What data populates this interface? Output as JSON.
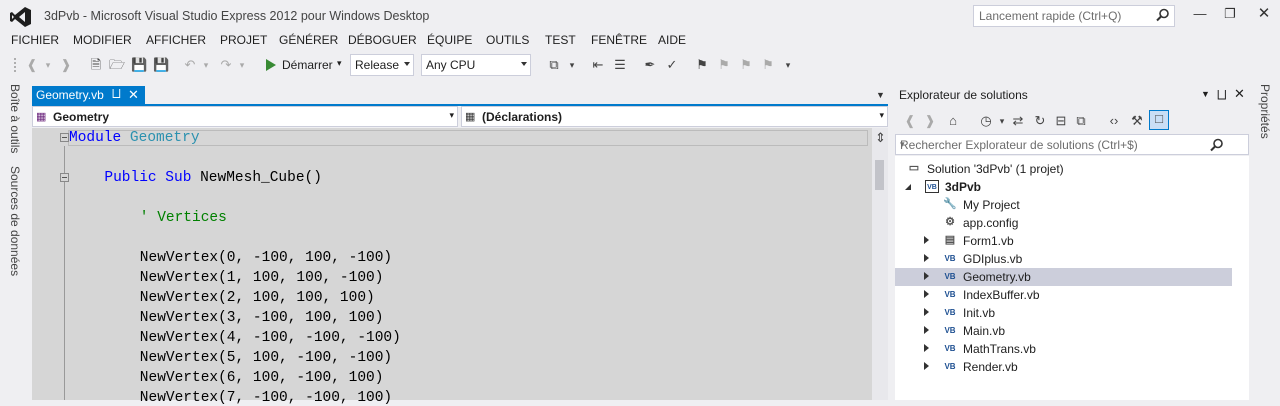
{
  "window": {
    "title": "3dPvb - Microsoft Visual Studio Express 2012 pour Windows Desktop",
    "quick_launch_placeholder": "Lancement rapide (Ctrl+Q)"
  },
  "menu": [
    "FICHIER",
    "MODIFIER",
    "AFFICHER",
    "PROJET",
    "GÉNÉRER",
    "DÉBOGUER",
    "ÉQUIPE",
    "OUTILS",
    "TEST",
    "FENÊTRE",
    "AIDE"
  ],
  "toolbar": {
    "start_label": "Démarrer",
    "config": "Release",
    "platform": "Any CPU"
  },
  "left_tabs": [
    "Boîte à outils",
    "Sources de données"
  ],
  "right_tabs": [
    "Propriétés"
  ],
  "editor": {
    "tab_label": "Geometry.vb",
    "nav_left": "Geometry",
    "nav_right": "(Déclarations)",
    "lines": [
      {
        "indent": 0,
        "parts": [
          {
            "c": "kw",
            "t": "Module "
          },
          {
            "c": "ty",
            "t": "Geometry"
          }
        ]
      },
      {
        "indent": 4,
        "parts": [
          {
            "c": "kw",
            "t": "Public Sub "
          },
          {
            "c": "",
            "t": "NewMesh_Cube()"
          }
        ]
      },
      {
        "indent": 8,
        "parts": [
          {
            "c": "cm",
            "t": "' Vertices"
          }
        ]
      },
      {
        "indent": 8,
        "parts": [
          {
            "c": "",
            "t": "NewVertex(0, -100, 100, -100)"
          }
        ]
      },
      {
        "indent": 8,
        "parts": [
          {
            "c": "",
            "t": "NewVertex(1, 100, 100, -100)"
          }
        ]
      },
      {
        "indent": 8,
        "parts": [
          {
            "c": "",
            "t": "NewVertex(2, 100, 100, 100)"
          }
        ]
      },
      {
        "indent": 8,
        "parts": [
          {
            "c": "",
            "t": "NewVertex(3, -100, 100, 100)"
          }
        ]
      },
      {
        "indent": 8,
        "parts": [
          {
            "c": "",
            "t": "NewVertex(4, -100, -100, -100)"
          }
        ]
      },
      {
        "indent": 8,
        "parts": [
          {
            "c": "",
            "t": "NewVertex(5, 100, -100, -100)"
          }
        ]
      },
      {
        "indent": 8,
        "parts": [
          {
            "c": "",
            "t": "NewVertex(6, 100, -100, 100)"
          }
        ]
      },
      {
        "indent": 8,
        "parts": [
          {
            "c": "",
            "t": "NewVertex(7, -100, -100, 100)"
          }
        ]
      }
    ]
  },
  "solution_explorer": {
    "title": "Explorateur de solutions",
    "search_placeholder": "Rechercher Explorateur de solutions (Ctrl+$)",
    "items": [
      {
        "label": "Solution '3dPvb' (1 projet)",
        "icon": "solution-icon",
        "expand": "none",
        "bold": false,
        "selected": false
      },
      {
        "label": "3dPvb",
        "icon": "vb-project-icon",
        "expand": "expanded",
        "bold": true,
        "selected": false
      },
      {
        "label": "My Project",
        "icon": "wrench-icon",
        "expand": "none",
        "bold": false,
        "selected": false
      },
      {
        "label": "app.config",
        "icon": "config-file-icon",
        "expand": "none",
        "bold": false,
        "selected": false
      },
      {
        "label": "Form1.vb",
        "icon": "form-icon",
        "expand": "collapsed",
        "bold": false,
        "selected": false
      },
      {
        "label": "GDIplus.vb",
        "icon": "vb-file-icon",
        "expand": "collapsed",
        "bold": false,
        "selected": false
      },
      {
        "label": "Geometry.vb",
        "icon": "vb-file-icon",
        "expand": "collapsed",
        "bold": false,
        "selected": true
      },
      {
        "label": "IndexBuffer.vb",
        "icon": "vb-file-icon",
        "expand": "collapsed",
        "bold": false,
        "selected": false
      },
      {
        "label": "Init.vb",
        "icon": "vb-file-icon",
        "expand": "collapsed",
        "bold": false,
        "selected": false
      },
      {
        "label": "Main.vb",
        "icon": "vb-file-icon",
        "expand": "collapsed",
        "bold": false,
        "selected": false
      },
      {
        "label": "MathTrans.vb",
        "icon": "vb-file-icon",
        "expand": "collapsed",
        "bold": false,
        "selected": false
      },
      {
        "label": "Render.vb",
        "icon": "vb-file-icon",
        "expand": "collapsed",
        "bold": false,
        "selected": false
      }
    ]
  },
  "colors": {
    "accent": "#007ACC",
    "keyword": "#0000FF",
    "type": "#2B91AF",
    "comment": "#008000",
    "selection": "#CCCEDB"
  }
}
